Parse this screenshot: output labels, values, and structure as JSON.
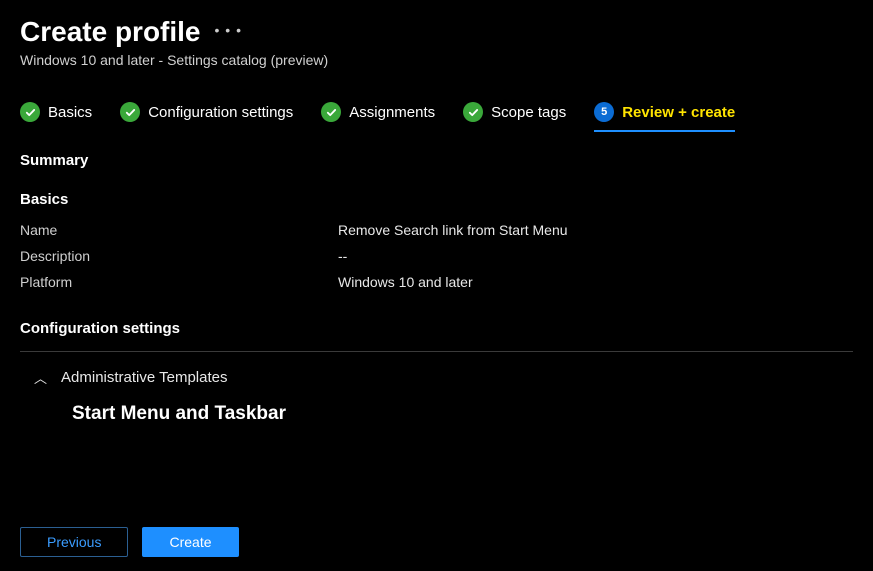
{
  "header": {
    "title": "Create profile",
    "subtitle": "Windows 10 and later - Settings catalog (preview)"
  },
  "steps": [
    {
      "label": "Basics",
      "state": "done"
    },
    {
      "label": "Configuration settings",
      "state": "done"
    },
    {
      "label": "Assignments",
      "state": "done"
    },
    {
      "label": "Scope tags",
      "state": "done"
    },
    {
      "label": "Review + create",
      "state": "active",
      "number": "5"
    }
  ],
  "summary": {
    "heading": "Summary",
    "basics": {
      "heading": "Basics",
      "rows": [
        {
          "key": "Name",
          "val": "Remove Search link from Start Menu"
        },
        {
          "key": "Description",
          "val": "--"
        },
        {
          "key": "Platform",
          "val": "Windows 10 and later"
        }
      ]
    },
    "config": {
      "heading": "Configuration settings",
      "tree_parent": "Administrative Templates",
      "tree_child": "Start Menu and Taskbar"
    }
  },
  "footer": {
    "previous": "Previous",
    "create": "Create"
  }
}
